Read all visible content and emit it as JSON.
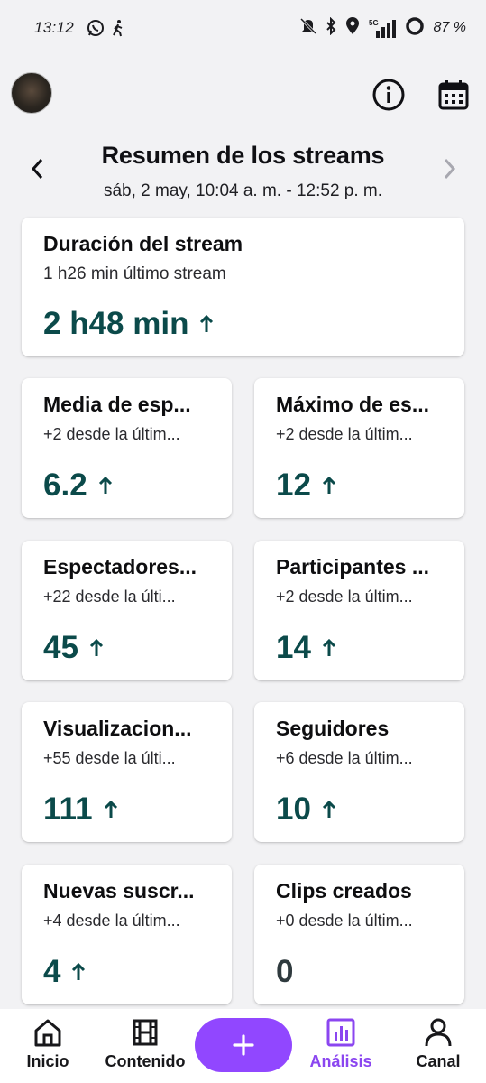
{
  "status_bar": {
    "time": "13:12",
    "battery_text": "87 %",
    "network_label": "5G"
  },
  "header": {
    "title": "Resumen de los streams",
    "subtitle": "sáb, 2 may, 10:04 a. m. - 12:52 p. m."
  },
  "cards": [
    {
      "title": "Duración del stream",
      "subtitle": "1 h26 min último stream",
      "value": "2 h48 min",
      "trend": "up"
    },
    {
      "title": "Media de esp...",
      "subtitle": "+2 desde la últim...",
      "value": "6.2",
      "trend": "up"
    },
    {
      "title": "Máximo de es...",
      "subtitle": "+2 desde la últim...",
      "value": "12",
      "trend": "up"
    },
    {
      "title": "Espectadores...",
      "subtitle": "+22 desde la últi...",
      "value": "45",
      "trend": "up"
    },
    {
      "title": "Participantes ...",
      "subtitle": "+2 desde la últim...",
      "value": "14",
      "trend": "up"
    },
    {
      "title": "Visualizacion...",
      "subtitle": "+55 desde la últi...",
      "value": "111",
      "trend": "up"
    },
    {
      "title": "Seguidores",
      "subtitle": "+6 desde la últim...",
      "value": "10",
      "trend": "up"
    },
    {
      "title": "Nuevas suscr...",
      "subtitle": "+4 desde la últim...",
      "value": "4",
      "trend": "up"
    },
    {
      "title": "Clips creados",
      "subtitle": "+0 desde la últim...",
      "value": "0",
      "trend": "none"
    }
  ],
  "bottom_nav": {
    "items": [
      {
        "label": "Inicio",
        "icon": "home-icon"
      },
      {
        "label": "Contenido",
        "icon": "film-icon"
      },
      {
        "label": "Análisis",
        "icon": "chart-icon",
        "active": true
      },
      {
        "label": "Canal",
        "icon": "person-icon"
      }
    ],
    "fab_icon": "plus-icon"
  },
  "colors": {
    "accent": "#9147ff",
    "value_teal": "#0b4a4a",
    "background": "#f2f2f4"
  }
}
